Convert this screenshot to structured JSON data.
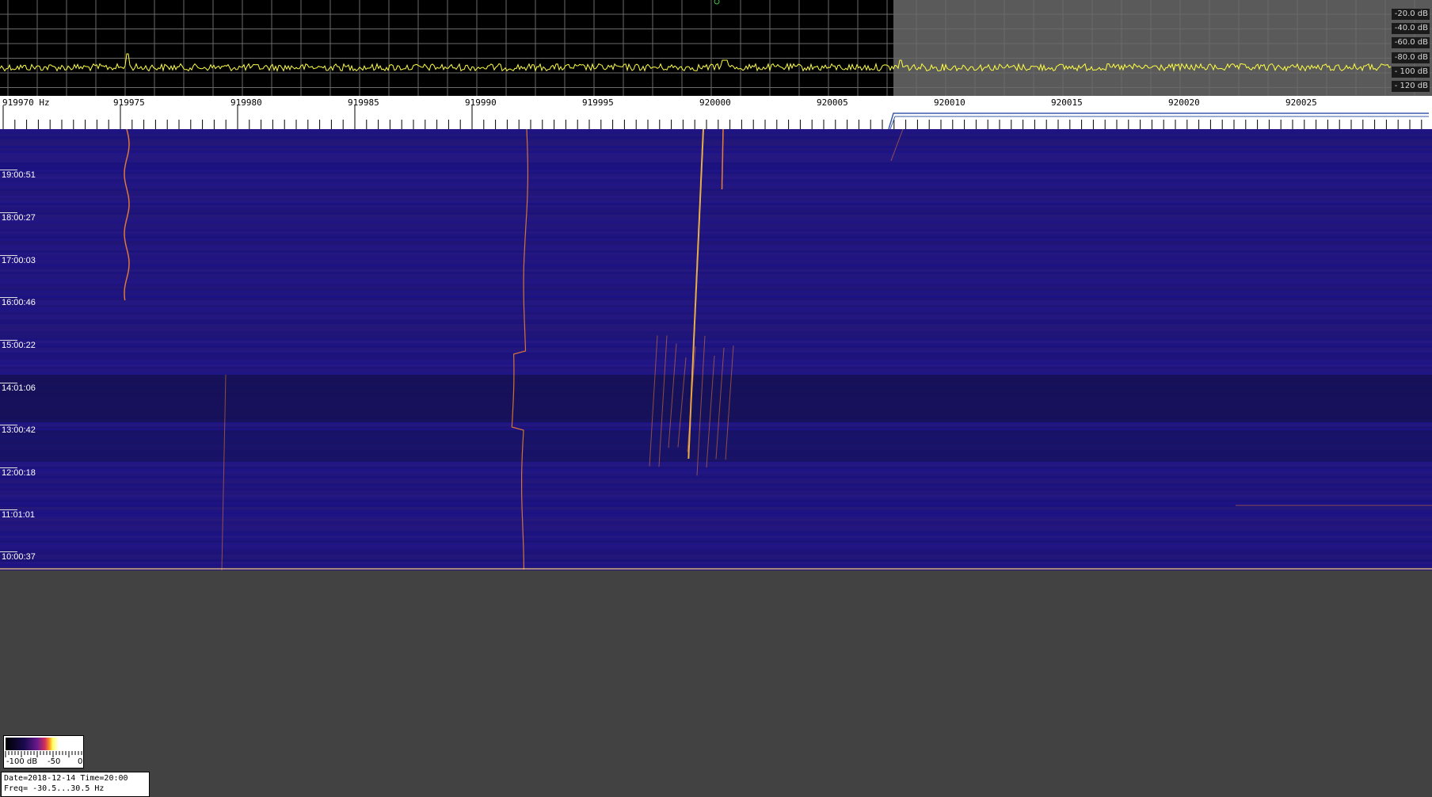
{
  "spectrum": {
    "db_labels": [
      "-20.0 dB",
      "-40.0 dB",
      "-60.0 dB",
      "-80.0 dB",
      "- 100 dB",
      "- 120 dB"
    ],
    "trace_color": "#ffff40",
    "grid_color": "#6a6a6a",
    "background_left": "#000000",
    "background_right": "#5a5a5a"
  },
  "ruler": {
    "start_label": "919970 Hz",
    "freq_labels": [
      "919975",
      "919980",
      "919985",
      "919990",
      "919995",
      "920000",
      "920005",
      "920010",
      "920015",
      "920020",
      "920025"
    ]
  },
  "waterfall": {
    "time_labels": [
      "19:00:51",
      "18:00:27",
      "17:00:03",
      "16:00:46",
      "15:00:22",
      "14:01:06",
      "13:00:42",
      "12:00:18",
      "11:01:01",
      "10:00:37"
    ],
    "background_color": "#1e1785",
    "signal_color": "#ff8a2a"
  },
  "colorbar": {
    "labels": [
      "-100 dB",
      "-50",
      "0"
    ]
  },
  "info": {
    "line1": "Date=2018-12-14 Time=20:00",
    "line2": "Freq= -30.5...30.5 Hz"
  }
}
